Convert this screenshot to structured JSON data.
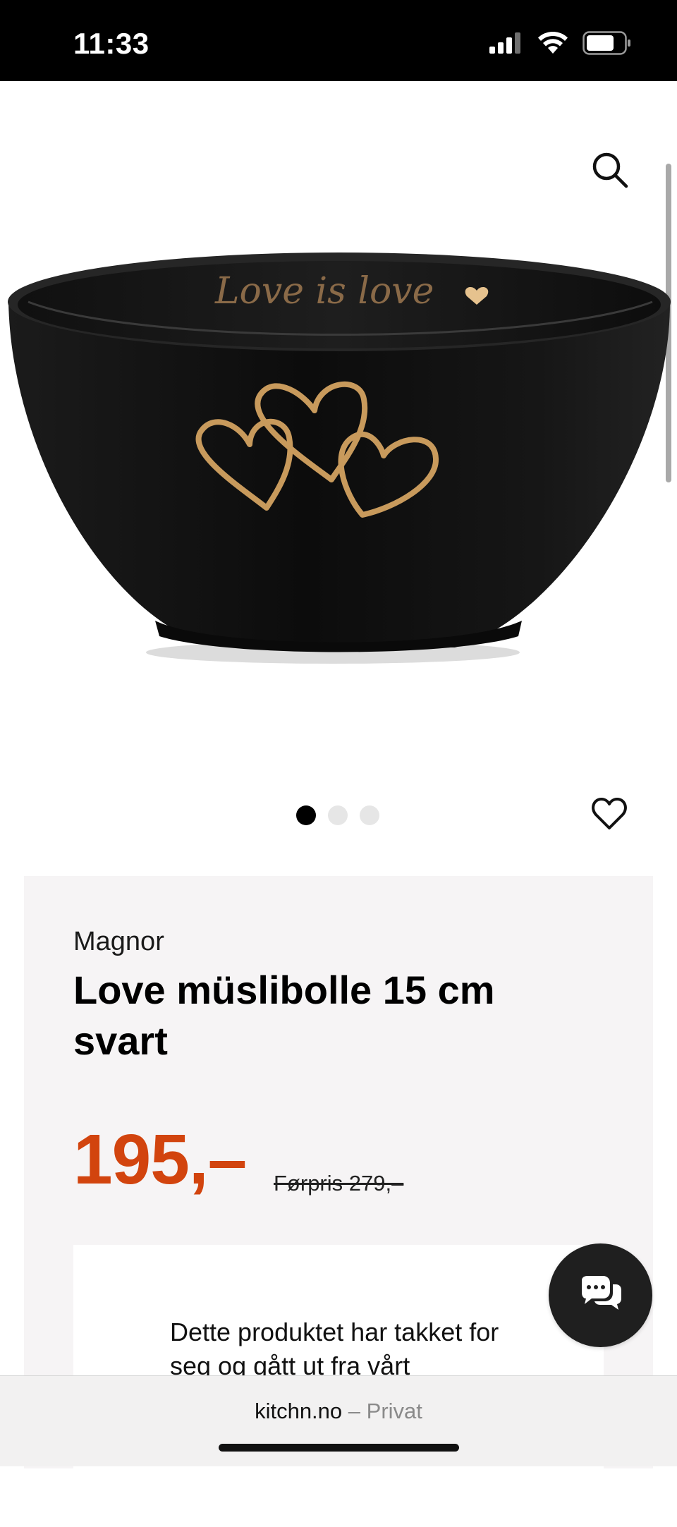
{
  "status_bar": {
    "time": "11:33",
    "icons": [
      "cellular-signal-icon",
      "wifi-icon",
      "battery-icon"
    ]
  },
  "header": {
    "search_icon": "search-icon"
  },
  "product_image": {
    "bowl_inscription": "Love is love",
    "colors": {
      "bowl": "#141414",
      "gold": "#c89a5c"
    }
  },
  "carousel": {
    "total": 3,
    "active_index": 0
  },
  "favorite_icon": "heart-outline-icon",
  "product": {
    "brand": "Magnor",
    "title": "Love müslibolle 15 cm svart",
    "price": "195,–",
    "old_price": "Førpris 279,–",
    "notice": "Dette produktet har takket for seg og gått ut fra vårt"
  },
  "chat": {
    "icon": "chat-bubbles-icon"
  },
  "browser": {
    "domain": "kitchn.no",
    "separator": "–",
    "mode": "Privat"
  },
  "colors": {
    "price_accent": "#d2440e",
    "panel_bg": "#f6f4f5",
    "chat_bg": "#1f1f1f"
  }
}
